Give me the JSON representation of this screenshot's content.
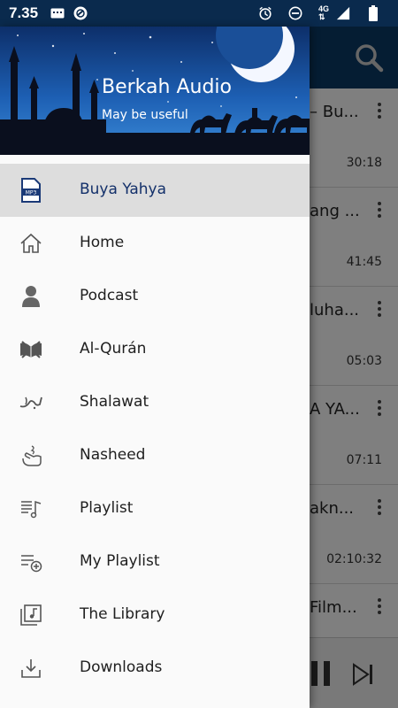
{
  "status_bar": {
    "time": "7.35",
    "network": "4G",
    "icons": [
      "notification-icon",
      "vpn-shield-icon",
      "alarm-icon",
      "do-not-disturb-icon",
      "network-4g-icon",
      "signal-icon",
      "battery-icon"
    ]
  },
  "drawer": {
    "app_name": "Berkah Audio",
    "tagline": "May be useful",
    "items": [
      {
        "label": "Buya Yahya",
        "icon": "mp3-file-icon",
        "active": true
      },
      {
        "label": "Home",
        "icon": "home-icon"
      },
      {
        "label": "Podcast",
        "icon": "person-icon"
      },
      {
        "label": "Al-Qurán",
        "icon": "quran-icon"
      },
      {
        "label": "Shalawat",
        "icon": "muhammad-calligraphy-icon"
      },
      {
        "label": "Nasheed",
        "icon": "nasheed-hand-icon"
      },
      {
        "label": "Playlist",
        "icon": "playlist-music-icon"
      },
      {
        "label": "My Playlist",
        "icon": "playlist-add-icon"
      },
      {
        "label": "The Library",
        "icon": "library-music-icon"
      },
      {
        "label": "Downloads",
        "icon": "download-icon"
      }
    ]
  },
  "background_list": {
    "rows": [
      {
        "title": "– Bu...",
        "duration": "30:18"
      },
      {
        "title": "ang ...",
        "duration": "41:45"
      },
      {
        "title": "luha...",
        "duration": "05:03"
      },
      {
        "title": "A YA...",
        "duration": "07:11"
      },
      {
        "title": "akn...",
        "duration": "02:10:32"
      },
      {
        "title": "Film...",
        "duration": ""
      }
    ]
  },
  "colors": {
    "status_bar": "#0a2a4d",
    "toolbar": "#0b3a66",
    "active_item_bg": "#dddddd",
    "active_item_text": "#13306a"
  }
}
